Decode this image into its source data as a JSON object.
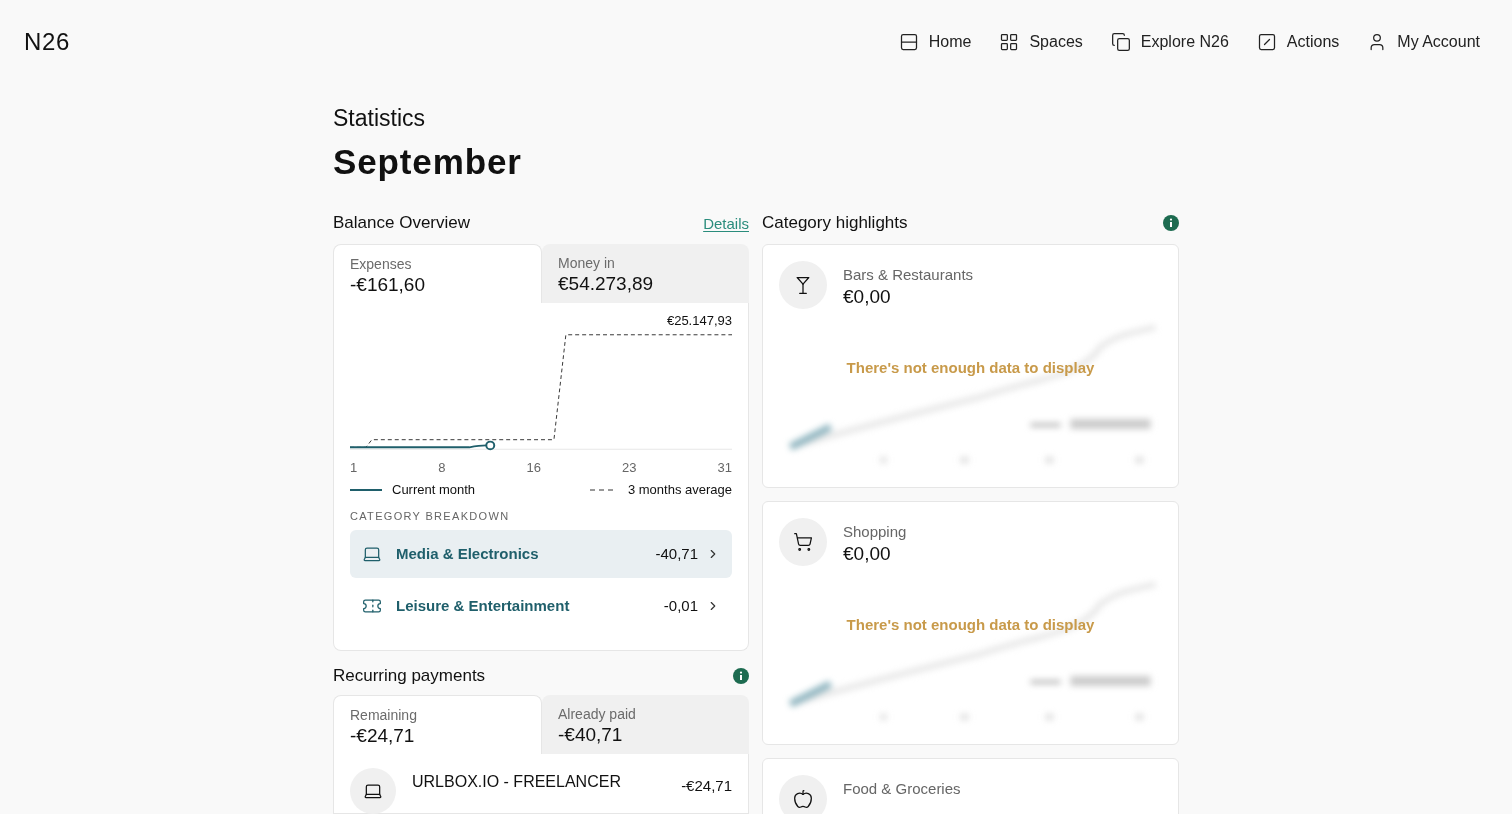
{
  "header": {
    "logo": "N26",
    "nav": [
      {
        "label": "Home"
      },
      {
        "label": "Spaces"
      },
      {
        "label": "Explore N26"
      },
      {
        "label": "Actions"
      },
      {
        "label": "My Account"
      }
    ]
  },
  "page": {
    "subtitle": "Statistics",
    "title": "September"
  },
  "balance_overview": {
    "title": "Balance Overview",
    "details_link": "Details",
    "tabs": [
      {
        "label": "Expenses",
        "amount": "-€161,60",
        "selected": true
      },
      {
        "label": "Money in",
        "amount": "€54.273,89",
        "selected": false
      }
    ],
    "chart": {
      "peak_label": "€25.147,93",
      "x_ticks": [
        "1",
        "8",
        "16",
        "23",
        "31"
      ],
      "legend": [
        "Current month",
        "3 months average"
      ]
    },
    "breakdown_title": "CATEGORY BREAKDOWN",
    "categories": [
      {
        "name": "Media & Electronics",
        "amount": "-40,71",
        "selected": true
      },
      {
        "name": "Leisure & Entertainment",
        "amount": "-0,01",
        "selected": false
      }
    ]
  },
  "recurring_payments": {
    "title": "Recurring payments",
    "tabs": [
      {
        "label": "Remaining",
        "amount": "-€24,71",
        "selected": true
      },
      {
        "label": "Already paid",
        "amount": "-€40,71",
        "selected": false
      }
    ],
    "payments": [
      {
        "name": "URLBOX.IO - FREELANCER",
        "amount": "-€24,71"
      }
    ]
  },
  "category_highlights": {
    "title": "Category highlights",
    "cards": [
      {
        "name": "Bars & Restaurants",
        "amount": "€0,00",
        "message": "There's not enough data to display"
      },
      {
        "name": "Shopping",
        "amount": "€0,00",
        "message": "There's not enough data to display"
      },
      {
        "name": "Food & Groceries"
      }
    ]
  }
}
